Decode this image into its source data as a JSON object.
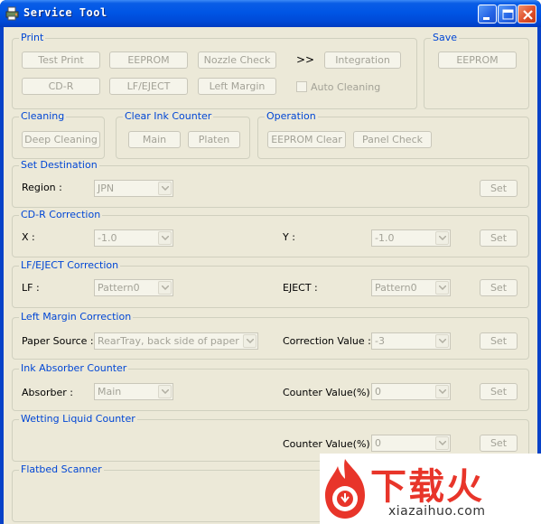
{
  "window": {
    "title": "Service Tool"
  },
  "print": {
    "label": "Print",
    "test_print": "Test Print",
    "eeprom": "EEPROM",
    "nozzle_check": "Nozzle Check",
    "arrows": ">>",
    "integration": "Integration",
    "cdr": "CD-R",
    "lf_eject": "LF/EJECT",
    "left_margin": "Left Margin",
    "auto_cleaning": "Auto Cleaning"
  },
  "save": {
    "label": "Save",
    "eeprom": "EEPROM"
  },
  "cleaning": {
    "label": "Cleaning",
    "deep_cleaning": "Deep Cleaning"
  },
  "clear_ink_counter": {
    "label": "Clear Ink Counter",
    "main": "Main",
    "platen": "Platen"
  },
  "operation": {
    "label": "Operation",
    "eeprom_clear": "EEPROM Clear",
    "panel_check": "Panel Check"
  },
  "set_destination": {
    "label": "Set Destination",
    "region_label": "Region :",
    "region_value": "JPN",
    "set": "Set"
  },
  "cdr_correction": {
    "label": "CD-R Correction",
    "x_label": "X :",
    "x_value": "-1.0",
    "y_label": "Y :",
    "y_value": "-1.0",
    "set": "Set"
  },
  "lf_eject_correction": {
    "label": "LF/EJECT Correction",
    "lf_label": "LF :",
    "lf_value": "Pattern0",
    "eject_label": "EJECT :",
    "eject_value": "Pattern0",
    "set": "Set"
  },
  "left_margin_correction": {
    "label": "Left Margin Correction",
    "paper_source_label": "Paper Source :",
    "paper_source_value": "RearTray, back side of paper",
    "correction_label": "Correction Value :",
    "correction_value": "-3",
    "set": "Set"
  },
  "ink_absorber_counter": {
    "label": "Ink Absorber Counter",
    "absorber_label": "Absorber :",
    "absorber_value": "Main",
    "counter_label": "Counter Value(%) :",
    "counter_value": "0",
    "set": "Set"
  },
  "wetting_liquid_counter": {
    "label": "Wetting Liquid Counter",
    "counter_label": "Counter Value(%) :",
    "counter_value": "0",
    "set": "Set"
  },
  "flatbed_scanner": {
    "label": "Flatbed Scanner"
  },
  "watermark": {
    "cn": "下载火",
    "en": "xiazaihuo.com"
  }
}
